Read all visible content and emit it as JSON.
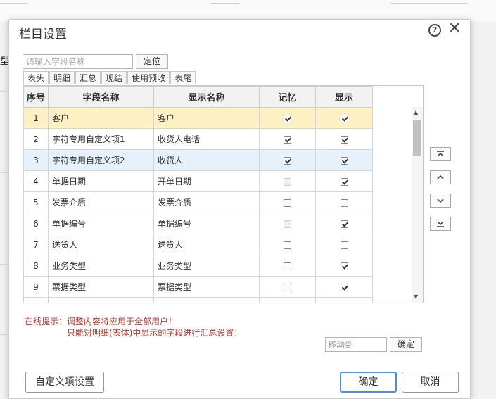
{
  "background": {
    "left_char": "型"
  },
  "dialog": {
    "title": "栏目设置",
    "help_icon": "question-circle-icon",
    "close_icon": "close-icon",
    "search": {
      "placeholder": "请输入字段名称",
      "value": ""
    },
    "locate_label": "定位",
    "tabs": [
      "表头",
      "明细",
      "汇总",
      "现结",
      "使用预收",
      "表尾"
    ],
    "active_tab": "表头",
    "table": {
      "headers": [
        "序号",
        "字段名称",
        "显示名称",
        "记忆",
        "显示"
      ],
      "rows": [
        {
          "seq": "1",
          "field": "客户",
          "display": "客户",
          "remember": "checked",
          "show": "checked"
        },
        {
          "seq": "2",
          "field": "字符专用自定义项1",
          "display": "收货人电话",
          "remember": "checked",
          "show": "checked"
        },
        {
          "seq": "3",
          "field": "字符专用自定义项2",
          "display": "收货人",
          "remember": "checked",
          "show": "checked"
        },
        {
          "seq": "4",
          "field": "单据日期",
          "display": "开单日期",
          "remember": "disabled",
          "show": "checked"
        },
        {
          "seq": "5",
          "field": "发票介质",
          "display": "发票介质",
          "remember": "unchecked",
          "show": "unchecked"
        },
        {
          "seq": "6",
          "field": "单据编号",
          "display": "单据编号",
          "remember": "disabled",
          "show": "checked"
        },
        {
          "seq": "7",
          "field": "送货人",
          "display": "送货人",
          "remember": "unchecked",
          "show": "unchecked"
        },
        {
          "seq": "8",
          "field": "业务类型",
          "display": "业务类型",
          "remember": "unchecked",
          "show": "checked"
        },
        {
          "seq": "9",
          "field": "票据类型",
          "display": "票据类型",
          "remember": "unchecked",
          "show": "checked"
        }
      ]
    },
    "move_buttons": [
      "move-top-icon",
      "move-up-icon",
      "move-down-icon",
      "move-bottom-icon"
    ],
    "hint_line1": "在线提示：调整内容将应用于全部用户！",
    "hint_line2": "只能对明细(表体)中显示的字段进行汇总设置！",
    "move_to": {
      "placeholder": "移动到",
      "value": ""
    },
    "move_ok_label": "确定",
    "custom_button_label": "自定义项设置",
    "ok_label": "确定",
    "cancel_label": "取消",
    "colors": {
      "hint": "#b03a2e",
      "row_highlight": "#fcf0c4",
      "row_selected": "#e6f1fc",
      "primary_border": "#4a90d9"
    }
  }
}
